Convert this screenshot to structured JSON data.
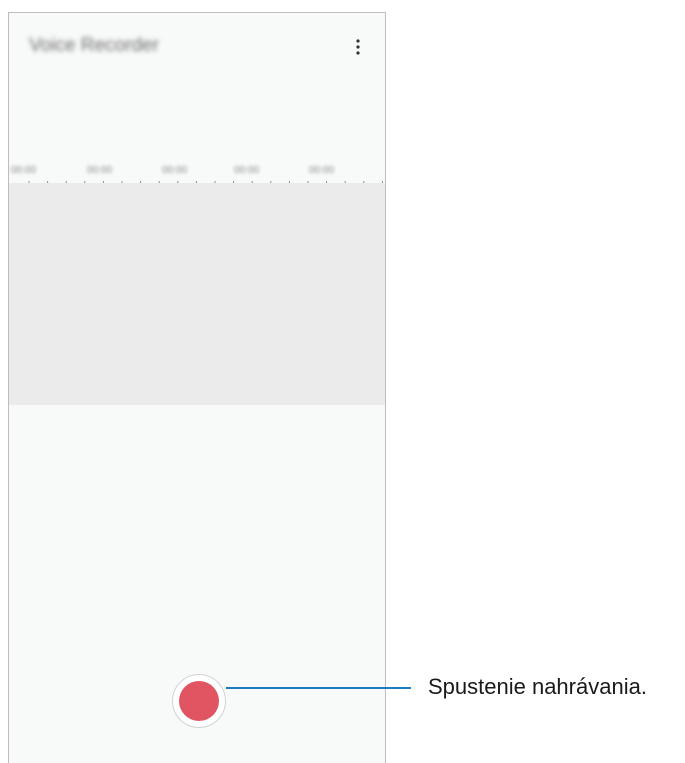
{
  "app": {
    "title": "Voice Recorder"
  },
  "header": {
    "more_options_icon": "more-vert-icon"
  },
  "timeline": {
    "labels": [
      "00:00",
      "00:00",
      "00:00",
      "00:00",
      "00:00"
    ]
  },
  "record_button": {
    "icon": "record-dot-icon",
    "color": "#e05561"
  },
  "callout": {
    "label": "Spustenie nahrávania.",
    "line_color": "#1a7bbf"
  }
}
